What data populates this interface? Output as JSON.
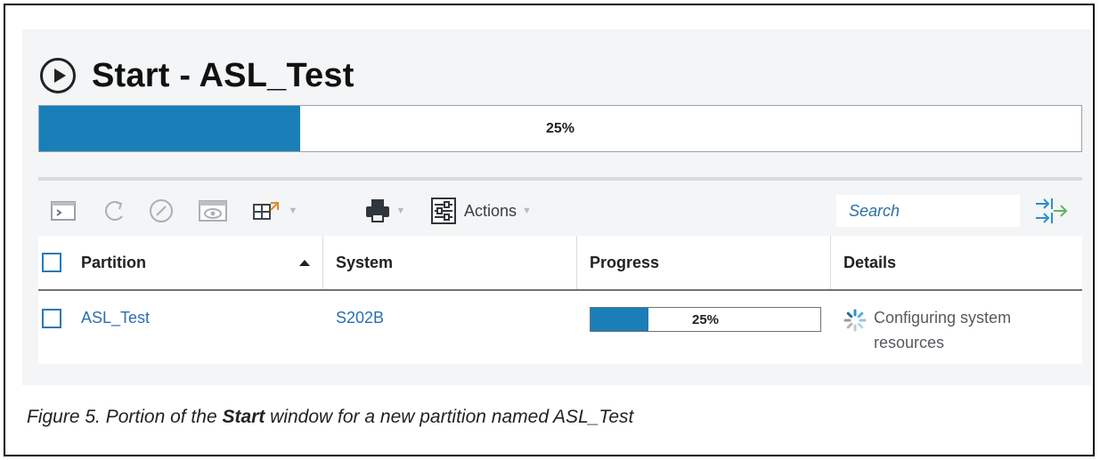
{
  "window": {
    "title": "Start - ASL_Test",
    "overall_progress": {
      "label": "25%",
      "value": 0.25
    }
  },
  "toolbar": {
    "icons": [
      "console-icon",
      "refresh-icon",
      "cancel-icon",
      "view-icon",
      "export-icon",
      "print-icon",
      "settings-icon"
    ],
    "actions_label": "Actions",
    "search_placeholder": "Search"
  },
  "table": {
    "columns": [
      "Partition",
      "System",
      "Progress",
      "Details"
    ],
    "rows": [
      {
        "partition": "ASL_Test",
        "system": "S202B",
        "progress_label": "25%",
        "progress_value": 0.25,
        "details": "Configuring system resources"
      }
    ]
  },
  "caption": {
    "prefix": "Figure 5. Portion of the ",
    "emphasis": "Start",
    "suffix": " window for a new partition named ASL_Test"
  },
  "colors": {
    "accent": "#1a7fb8",
    "link": "#2a6fb0",
    "background": "#f4f5f6"
  }
}
